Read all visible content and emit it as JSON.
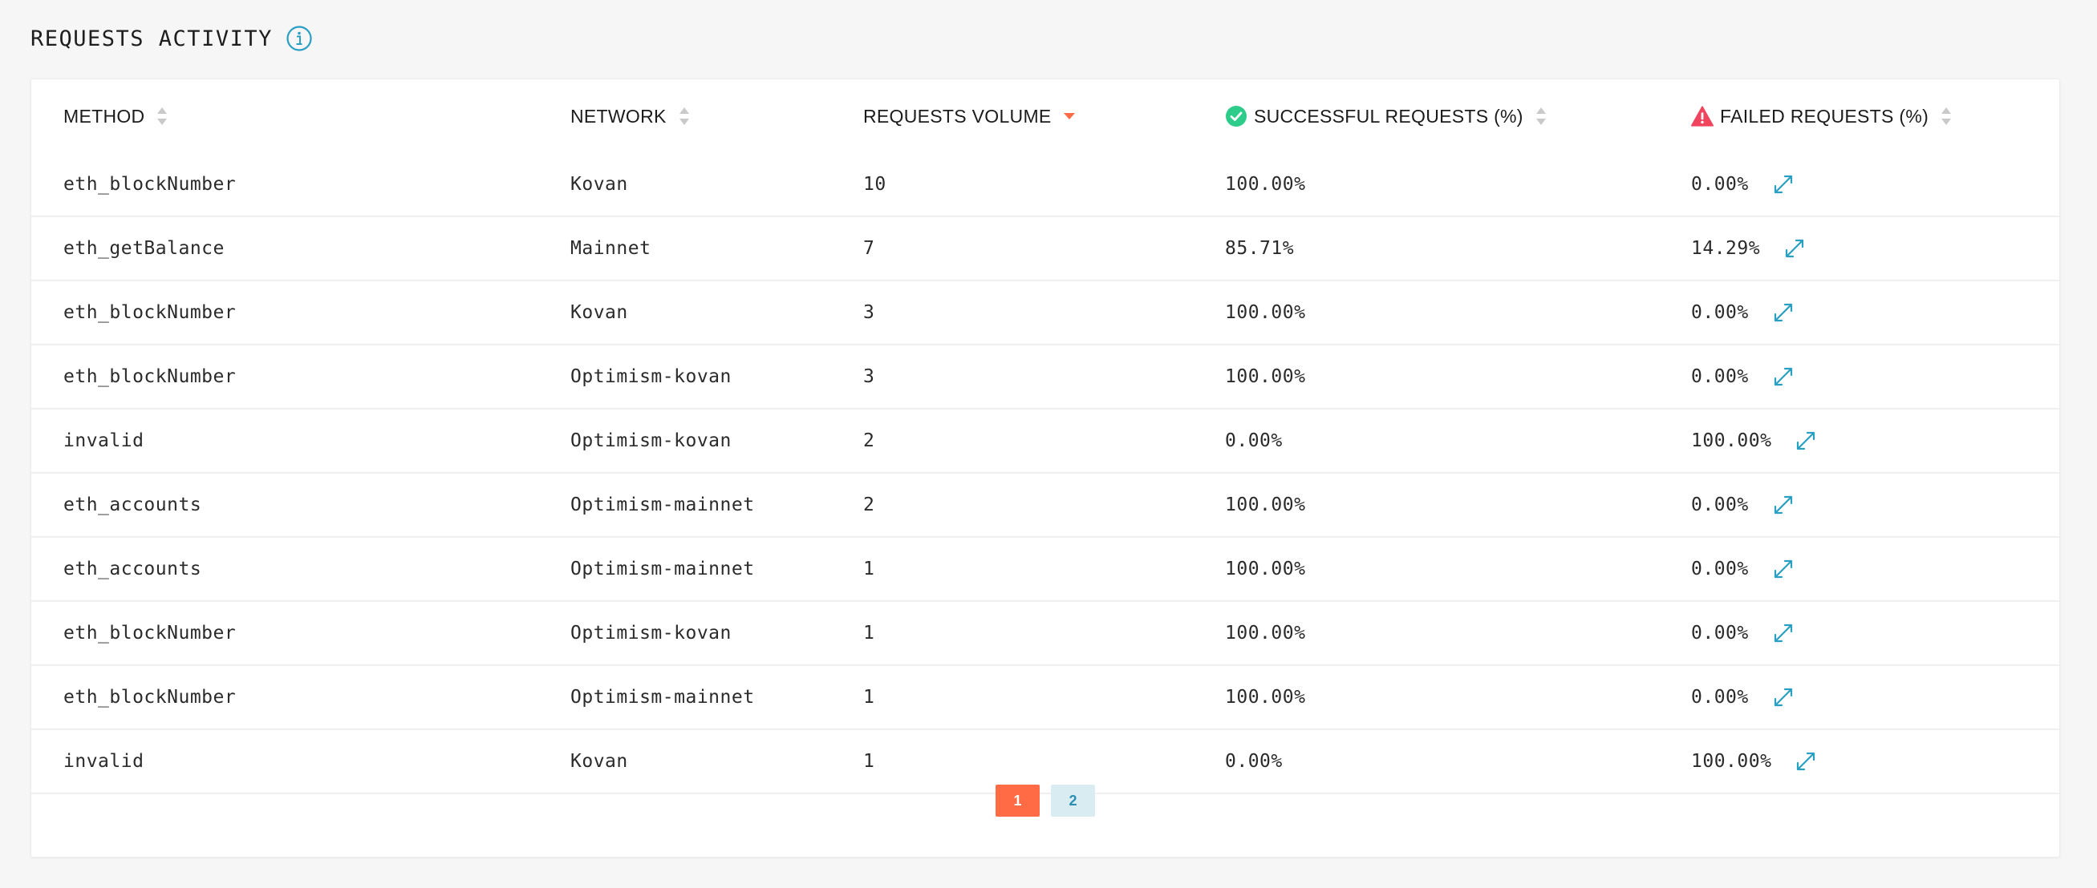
{
  "section": {
    "title": "REQUESTS ACTIVITY",
    "info_icon": "info-circle-icon"
  },
  "colors": {
    "accent": "#ff6b45",
    "link": "#2a9fc4",
    "success": "#2ecc8a",
    "error": "#f0455f",
    "pagination_inactive_bg": "#d9ecf2"
  },
  "table": {
    "columns": [
      {
        "key": "method",
        "label": "METHOD",
        "sort": "none"
      },
      {
        "key": "network",
        "label": "NETWORK",
        "sort": "none"
      },
      {
        "key": "volume",
        "label": "REQUESTS VOLUME",
        "sort": "desc"
      },
      {
        "key": "success",
        "label": "SUCCESSFUL REQUESTS (%)",
        "sort": "none",
        "icon": "check-circle-icon"
      },
      {
        "key": "failed",
        "label": "FAILED REQUESTS (%)",
        "sort": "none",
        "icon": "warning-triangle-icon"
      }
    ],
    "rows": [
      {
        "method": "eth_blockNumber",
        "network": "Kovan",
        "volume": "10",
        "success": "100.00%",
        "failed": "0.00%"
      },
      {
        "method": "eth_getBalance",
        "network": "Mainnet",
        "volume": "7",
        "success": "85.71%",
        "failed": "14.29%"
      },
      {
        "method": "eth_blockNumber",
        "network": "Kovan",
        "volume": "3",
        "success": "100.00%",
        "failed": "0.00%"
      },
      {
        "method": "eth_blockNumber",
        "network": "Optimism-kovan",
        "volume": "3",
        "success": "100.00%",
        "failed": "0.00%"
      },
      {
        "method": "invalid",
        "network": "Optimism-kovan",
        "volume": "2",
        "success": "0.00%",
        "failed": "100.00%"
      },
      {
        "method": "eth_accounts",
        "network": "Optimism-mainnet",
        "volume": "2",
        "success": "100.00%",
        "failed": "0.00%"
      },
      {
        "method": "eth_accounts",
        "network": "Optimism-mainnet",
        "volume": "1",
        "success": "100.00%",
        "failed": "0.00%"
      },
      {
        "method": "eth_blockNumber",
        "network": "Optimism-kovan",
        "volume": "1",
        "success": "100.00%",
        "failed": "0.00%"
      },
      {
        "method": "eth_blockNumber",
        "network": "Optimism-mainnet",
        "volume": "1",
        "success": "100.00%",
        "failed": "0.00%"
      },
      {
        "method": "invalid",
        "network": "Kovan",
        "volume": "1",
        "success": "0.00%",
        "failed": "100.00%"
      }
    ],
    "row_action_icon": "expand-icon"
  },
  "pagination": {
    "pages": [
      "1",
      "2"
    ],
    "current": "1"
  }
}
